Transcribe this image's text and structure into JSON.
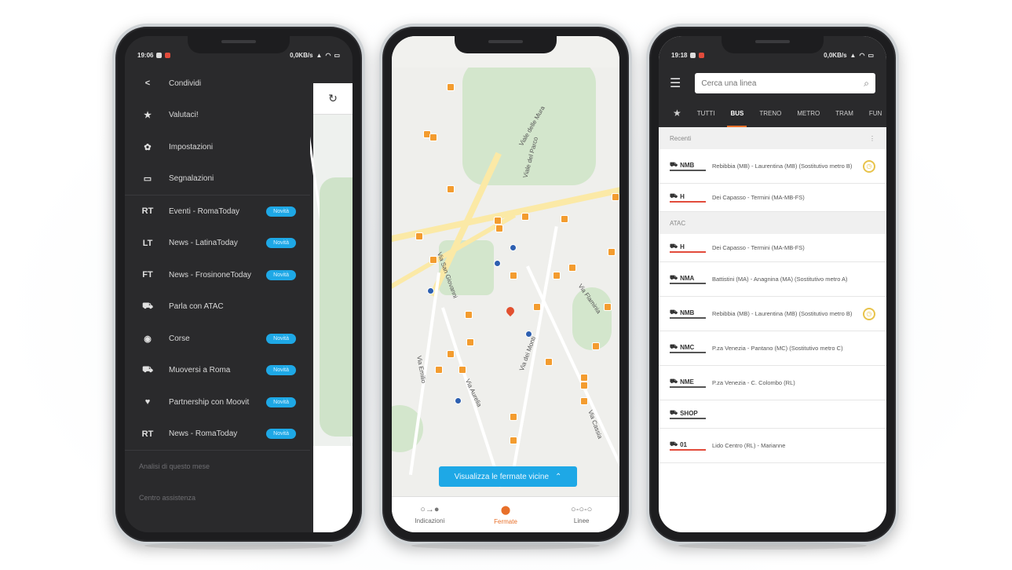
{
  "phone1": {
    "status_time": "19:06",
    "status_right": "0,0KB/s",
    "peek_icon": "↻",
    "menu_items": [
      {
        "icon": "share-icon",
        "glyph": "<",
        "label": "Condividi",
        "badge": ""
      },
      {
        "icon": "star-icon",
        "glyph": "★",
        "label": "Valutaci!",
        "badge": ""
      },
      {
        "icon": "gear-icon",
        "glyph": "✿",
        "label": "Impostazioni",
        "badge": ""
      },
      {
        "icon": "chat-icon",
        "glyph": "▭",
        "label": "Segnalazioni",
        "badge": ""
      },
      {
        "icon": "rt-icon",
        "glyph": "RT",
        "label": "Eventi - RomaToday",
        "badge": "Novità"
      },
      {
        "icon": "lt-icon",
        "glyph": "LT",
        "label": "News - LatinaToday",
        "badge": "Novità"
      },
      {
        "icon": "ft-icon",
        "glyph": "FT",
        "label": "News - FrosinoneToday",
        "badge": "Novità"
      },
      {
        "icon": "bus-icon",
        "glyph": "⛟",
        "label": "Parla con ATAC",
        "badge": ""
      },
      {
        "icon": "target-icon",
        "glyph": "◉",
        "label": "Corse",
        "badge": "Novità"
      },
      {
        "icon": "car-icon",
        "glyph": "⛟",
        "label": "Muoversi a Roma",
        "badge": "Novità"
      },
      {
        "icon": "handshake-icon",
        "glyph": "♥",
        "label": "Partnership con Moovit",
        "badge": "Novità"
      },
      {
        "icon": "rt2-icon",
        "glyph": "RT",
        "label": "News - RomaToday",
        "badge": "Novità"
      }
    ],
    "section_1": "Analisi di questo mese",
    "section_2": "Centro assistenza"
  },
  "phone2": {
    "street_labels": [
      "Viale delle Mura",
      "Viale del Parco",
      "Via dei Monti",
      "Via San Giovanni",
      "Via Emilio",
      "Via Aurelia",
      "Via Flaminia",
      "Via Cassia"
    ],
    "visualize_button": "Visualizza le fermate vicine",
    "nav": [
      {
        "icon": "directions-icon",
        "glyph": "○→●",
        "label": "Indicazioni",
        "active": false
      },
      {
        "icon": "location-pin-icon",
        "glyph": "⬤",
        "label": "Fermate",
        "active": true
      },
      {
        "icon": "lines-icon",
        "glyph": "○-○-○",
        "label": "Linee",
        "active": false
      }
    ]
  },
  "phone3": {
    "status_time": "19:18",
    "status_right": "0,0KB/s",
    "search_placeholder": "Cerca una linea",
    "tabs": [
      "TUTTI",
      "BUS",
      "TRENO",
      "METRO",
      "TRAM",
      "FUN"
    ],
    "active_tab": "BUS",
    "section_recent": "Recenti",
    "section_atac": "ATAC",
    "recent": [
      {
        "code": "NMB",
        "desc": "Rebibbia (MB) - Laurentina (MB) (Sostitutivo metro B)",
        "clock": true,
        "tall": true
      },
      {
        "code": "H",
        "desc": "Dei Capasso - Termini (MA-MB-FS)",
        "clock": false,
        "tall": false
      }
    ],
    "atac": [
      {
        "code": "H",
        "desc": "Dei Capasso - Termini (MA-MB-FS)",
        "clock": false,
        "tall": false
      },
      {
        "code": "NMA",
        "desc": "Battistini (MA) - Anagnina (MA) (Sostitutivo metro A)",
        "clock": false,
        "tall": true
      },
      {
        "code": "NMB",
        "desc": "Rebibbia (MB) - Laurentina (MB) (Sostitutivo metro B)",
        "clock": true,
        "tall": true
      },
      {
        "code": "NMC",
        "desc": "P.za Venezia - Pantano (MC) (Sostitutivo metro C)",
        "clock": false,
        "tall": true
      },
      {
        "code": "NME",
        "desc": "P.za Venezia - C. Colombo (RL)",
        "clock": false,
        "tall": true
      },
      {
        "code": "SHOP",
        "desc": "",
        "clock": false,
        "tall": false
      },
      {
        "code": "01",
        "desc": "Lido Centro (RL) - Marianne",
        "clock": false,
        "tall": true
      }
    ]
  },
  "colors": {
    "accent_orange": "#e8702a",
    "accent_blue": "#1ea8e6",
    "dark_bg": "#2a2a2c",
    "line_red": "#e24b3b"
  }
}
